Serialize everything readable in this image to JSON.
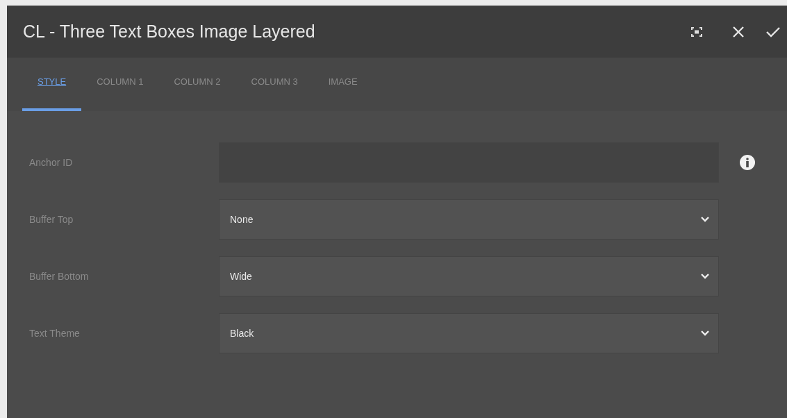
{
  "dialog": {
    "title": "CL - Three Text Boxes Image Layered"
  },
  "tabs": [
    {
      "label": "STYLE",
      "selected": true
    },
    {
      "label": "COLUMN 1",
      "selected": false
    },
    {
      "label": "COLUMN 2",
      "selected": false
    },
    {
      "label": "COLUMN 3",
      "selected": false
    },
    {
      "label": "IMAGE",
      "selected": false
    }
  ],
  "fields": [
    {
      "label": "Anchor ID",
      "kind": "text",
      "info": true
    },
    {
      "label": "Buffer Top",
      "kind": "select",
      "value": "None"
    },
    {
      "label": "Buffer Bottom",
      "kind": "select",
      "value": "Wide"
    },
    {
      "label": "Text Theme",
      "kind": "select",
      "value": "Black"
    }
  ]
}
